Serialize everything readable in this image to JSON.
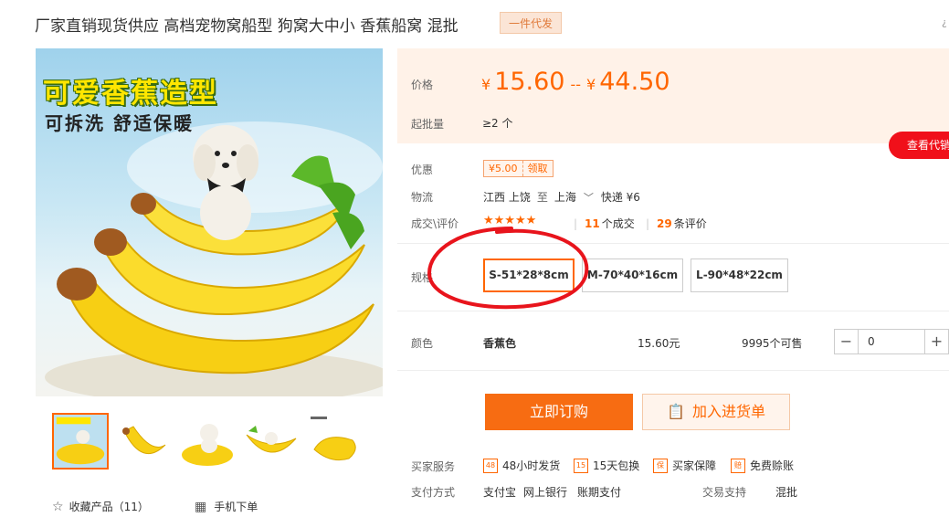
{
  "title": "厂家直销现货供应 高档宠物窝船型 狗窝大中小 香蕉船窝 混批",
  "title_badge": "一件代发",
  "edge_char": "¿",
  "image": {
    "slogan1": "可爱香蕉造型",
    "slogan2": "可拆洗 舒适保暖"
  },
  "favorite": {
    "icon": "star-outline-icon",
    "label": "收藏产品（11）"
  },
  "mobile_order": {
    "icon": "qr-code-icon",
    "label": "手机下单"
  },
  "price": {
    "label": "价格",
    "currency": "¥",
    "min": "15.60",
    "separator": "--",
    "max": "44.50"
  },
  "moq": {
    "label": "起批量",
    "value": "≥2 个"
  },
  "agent_button": "查看代销",
  "promo": {
    "label": "优惠",
    "amount": "¥5.00",
    "claim": "领取"
  },
  "logistics": {
    "label": "物流",
    "from": "江西 上饶",
    "to_word": "至",
    "dest": "上海",
    "shipping": "快递 ¥6"
  },
  "deals": {
    "label": "成交\\评价",
    "stars": "★★★★★",
    "deal_count": "11",
    "deal_suffix": "个成交",
    "review_count": "29",
    "review_suffix": "条评价"
  },
  "spec": {
    "label": "规格",
    "options": [
      "S-51*28*8cm",
      "M-70*40*16cm",
      "L-90*48*22cm"
    ],
    "selected": "S-51*28*8cm"
  },
  "color_row": {
    "label": "颜色",
    "value": "香蕉色",
    "unit_price": "15.60元",
    "stock": "9995个可售",
    "quantity": "0"
  },
  "buttons": {
    "buy": "立即订购",
    "cart": "加入进货单"
  },
  "services": {
    "label": "买家服务",
    "items": [
      {
        "icon": "48h-icon",
        "badge": "48",
        "label": "48小时发货"
      },
      {
        "icon": "15day-return-icon",
        "badge": "15",
        "label": "15天包换"
      },
      {
        "icon": "shield-icon",
        "badge": "保",
        "label": "买家保障"
      },
      {
        "icon": "free-compensation-icon",
        "badge": "赔",
        "label": "免费赊账"
      }
    ]
  },
  "payment": {
    "label": "支付方式",
    "methods": [
      "支付宝",
      "网上银行",
      "账期支付"
    ],
    "trade_label": "交易支持",
    "trade_value": "混批"
  },
  "colors": {
    "accent": "#ff6600",
    "price_bg": "#fff2e8",
    "red": "#f0101a",
    "annotation": "#e8141c"
  }
}
